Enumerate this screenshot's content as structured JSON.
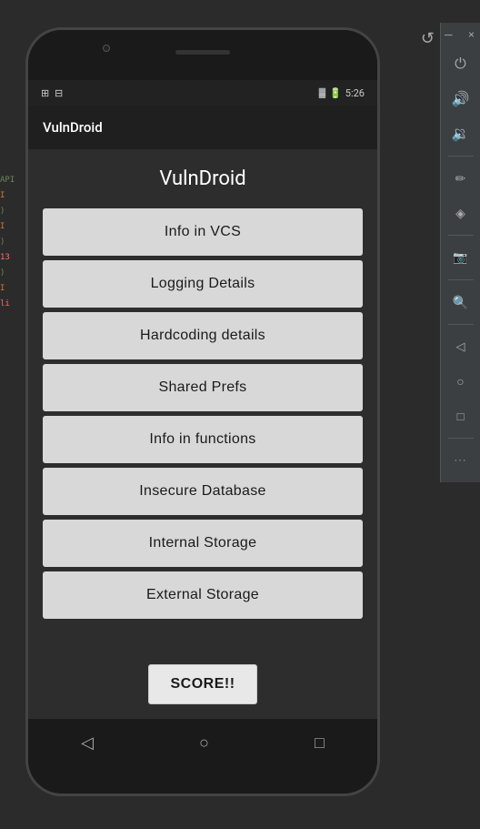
{
  "ide": {
    "background_color": "#2b2b2b"
  },
  "phone": {
    "speaker": "",
    "status_bar": {
      "left_text": "",
      "signal": "▓",
      "battery": "🔋",
      "time": "5:26"
    },
    "app_bar": {
      "title": "VulnDroid"
    },
    "screen": {
      "app_title": "VulnDroid",
      "menu_items": [
        "Info in VCS",
        "Logging Details",
        "Hardcoding details",
        "Shared Prefs",
        "Info in functions",
        "Insecure Database",
        "Internal Storage",
        "External Storage"
      ],
      "score_button": "SCORE!!"
    },
    "nav_bar": {
      "back_icon": "◁",
      "home_icon": "○",
      "recent_icon": "□"
    }
  },
  "right_toolbar": {
    "buttons": [
      {
        "icon": "⏻",
        "name": "power-icon"
      },
      {
        "icon": "🔊",
        "name": "volume-up-icon"
      },
      {
        "icon": "🔈",
        "name": "volume-down-icon"
      },
      {
        "icon": "✏️",
        "name": "rotate-icon"
      },
      {
        "icon": "⟳",
        "name": "rotate2-icon"
      },
      {
        "icon": "📷",
        "name": "screenshot-icon"
      },
      {
        "icon": "🔍",
        "name": "zoom-icon"
      },
      {
        "icon": "◁",
        "name": "back-icon"
      },
      {
        "icon": "○",
        "name": "home-nav-icon"
      },
      {
        "icon": "□",
        "name": "recent-nav-icon"
      },
      {
        "icon": "•••",
        "name": "more-icon"
      }
    ],
    "close": "×",
    "minimize": "─"
  }
}
